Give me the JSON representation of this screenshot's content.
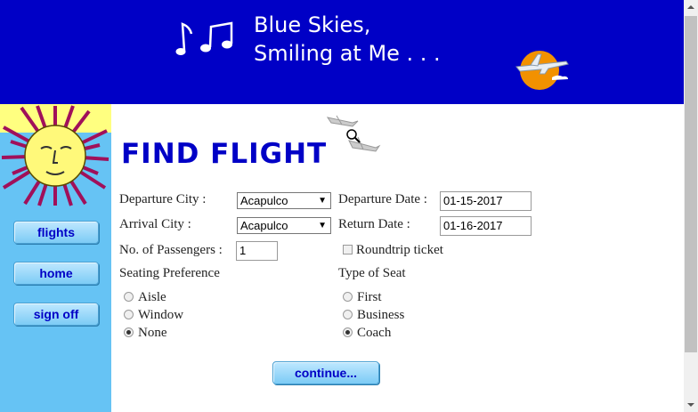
{
  "header": {
    "title": "Blue Skies,\nSmiling at Me . . ."
  },
  "sidebar": {
    "items": [
      {
        "label": "flights"
      },
      {
        "label": "home"
      },
      {
        "label": "sign off"
      }
    ]
  },
  "main": {
    "heading": "FIND FLIGHT",
    "departure_city": {
      "label": "Departure City :",
      "value": "Acapulco"
    },
    "arrival_city": {
      "label": "Arrival City :",
      "value": "Acapulco"
    },
    "departure_date": {
      "label": "Departure Date :",
      "value": "01-15-2017"
    },
    "return_date": {
      "label": "Return Date :",
      "value": "01-16-2017"
    },
    "passengers": {
      "label": "No. of Passengers :",
      "value": "1"
    },
    "roundtrip": {
      "label": "Roundtrip ticket",
      "checked": false
    },
    "seating_preference": {
      "label": "Seating Preference",
      "options": [
        "Aisle",
        "Window",
        "None"
      ],
      "selected": "None"
    },
    "seat_type": {
      "label": "Type of Seat",
      "options": [
        "First",
        "Business",
        "Coach"
      ],
      "selected": "Coach"
    },
    "continue_label": "continue..."
  },
  "colors": {
    "banner": "#0000c6",
    "sidebar": "#66c3f4",
    "heading": "#0000c6"
  }
}
